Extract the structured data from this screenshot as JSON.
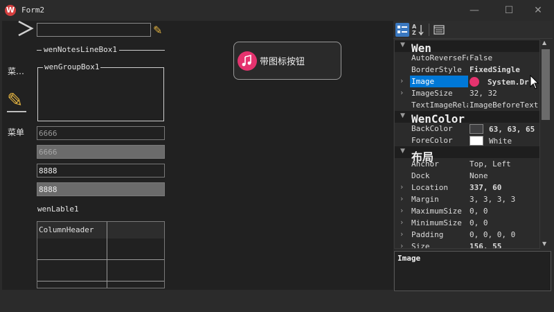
{
  "window": {
    "title": "Form2",
    "minimize": "—",
    "maximize": "☐",
    "close": "✕"
  },
  "left": {
    "menu1_label": "菜…",
    "menu2_label": "菜单",
    "notes_line_label": "wenNotesLineBox1",
    "group_label": "wenGroupBox1",
    "field1_value": "6666",
    "field2_value": "6666",
    "field3_value": "8888",
    "field4_value": "8888",
    "lable_text": "wenLable1",
    "grid_header": "ColumnHeader"
  },
  "music_button": {
    "label": "带图标按钮",
    "icon": "music-note-icon"
  },
  "property_grid": {
    "toolbar": {
      "categorized": "categorized-icon",
      "alphabetical": "sort-alpha-icon",
      "pages": "property-pages-icon",
      "alpha_text": "A Z"
    },
    "rows": [
      {
        "type": "cat",
        "name": "Wen"
      },
      {
        "type": "prop",
        "name": "AutoReverseFo",
        "value": "False"
      },
      {
        "type": "prop",
        "name": "BorderStyle",
        "value": "FixedSingle",
        "bold": true
      },
      {
        "type": "prop",
        "name": "Image",
        "value": "System.Dr",
        "bold": true,
        "selected": true,
        "expand": true,
        "swatch": "#e4336e"
      },
      {
        "type": "prop",
        "name": "ImageSize",
        "value": "32, 32",
        "expand": true
      },
      {
        "type": "prop",
        "name": "TextImageRela",
        "value": "ImageBeforeText"
      },
      {
        "type": "cat",
        "name": "WenColor"
      },
      {
        "type": "prop",
        "name": "BackColor",
        "value": "63, 63, 65",
        "bold": true,
        "swatch": "#3f3f41"
      },
      {
        "type": "prop",
        "name": "ForeColor",
        "value": "White",
        "swatch": "#ffffff"
      },
      {
        "type": "cat",
        "name": "布局"
      },
      {
        "type": "prop",
        "name": "Anchor",
        "value": "Top, Left"
      },
      {
        "type": "prop",
        "name": "Dock",
        "value": "None"
      },
      {
        "type": "prop",
        "name": "Location",
        "value": "337, 60",
        "bold": true,
        "expand": true
      },
      {
        "type": "prop",
        "name": "Margin",
        "value": "3, 3, 3, 3",
        "expand": true
      },
      {
        "type": "prop",
        "name": "MaximumSize",
        "value": "0, 0",
        "expand": true
      },
      {
        "type": "prop",
        "name": "MinimumSize",
        "value": "0, 0",
        "expand": true
      },
      {
        "type": "prop",
        "name": "Padding",
        "value": "0, 0, 0, 0",
        "expand": true
      },
      {
        "type": "prop",
        "name": "Size",
        "value": "156, 55",
        "bold": true,
        "expand": true
      }
    ],
    "description_title": "Image",
    "scroll_up": "▲",
    "scroll_down": "▼"
  },
  "colors": {
    "accent": "#0078d7",
    "background": "#212121",
    "music": "#e4336e"
  }
}
